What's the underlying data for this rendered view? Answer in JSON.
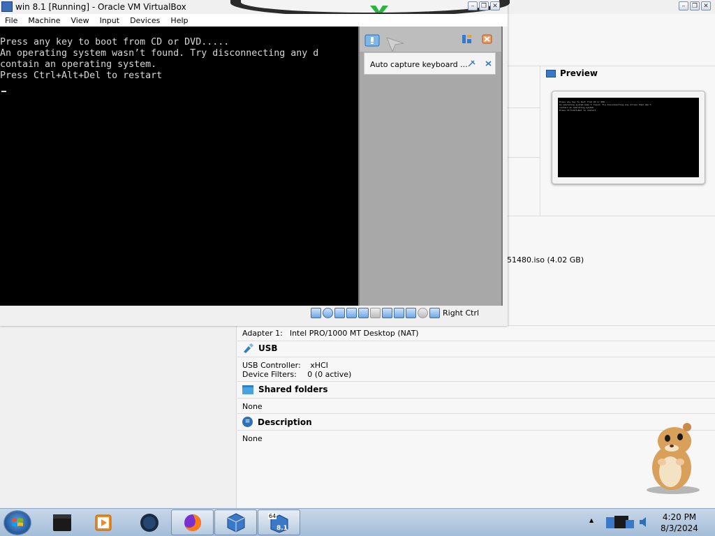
{
  "manager": {
    "preview_title": "Preview",
    "preview_screen_lines": [
      "Press any key to boot from CD or DVD.....",
      "An operating system wasn't found. Try disconnecting any drives that don't",
      "contain an operating system.",
      "Press Ctrl+Alt+Del to restart"
    ],
    "iso_text": "51480.iso (4.02 GB)",
    "network_adapter": {
      "key": "Adapter 1:",
      "value": "Intel PRO/1000 MT Desktop (NAT)"
    },
    "usb": {
      "title": "USB",
      "controller_key": "USB Controller:",
      "controller_value": "xHCI",
      "filters_key": "Device Filters:",
      "filters_value": "0 (0 active)"
    },
    "shared_folders": {
      "title": "Shared folders",
      "value": "None"
    },
    "description": {
      "title": "Description",
      "value": "None"
    }
  },
  "vm_window": {
    "title": "win 8.1 [Running] - Oracle VM VirtualBox",
    "menu": [
      "File",
      "Machine",
      "View",
      "Input",
      "Devices",
      "Help"
    ],
    "console_lines": [
      "Press any key to boot from CD or DVD.....",
      "An operating system wasn’t found. Try disconnecting any d",
      "contain an operating system.",
      "Press Ctrl+Alt+Del to restart"
    ],
    "notification": {
      "text": "Auto capture keyboard ..."
    },
    "host_key": "Right Ctrl"
  },
  "taskbar": {
    "clock_time": "4:20 PM",
    "clock_date": "8/3/2024",
    "vbox_badge": "64",
    "vbox_badge2": "8.1"
  },
  "colors": {
    "console_bg": "#000000",
    "console_text": "#d7d7d7",
    "notice_panel": "#a8a8a8",
    "taskbar": "#b4c8df"
  }
}
